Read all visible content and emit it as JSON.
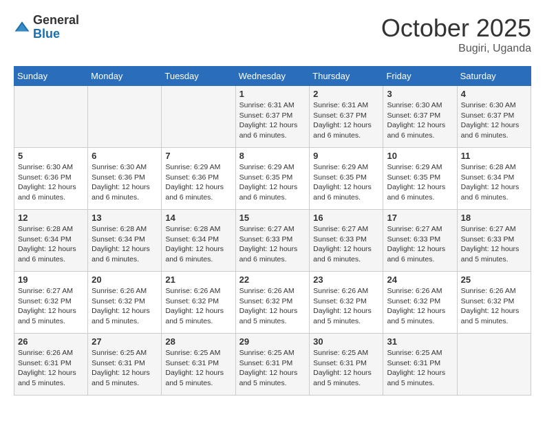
{
  "header": {
    "logo_general": "General",
    "logo_blue": "Blue",
    "month_title": "October 2025",
    "location": "Bugiri, Uganda"
  },
  "days_of_week": [
    "Sunday",
    "Monday",
    "Tuesday",
    "Wednesday",
    "Thursday",
    "Friday",
    "Saturday"
  ],
  "weeks": [
    [
      {
        "day": "",
        "info": ""
      },
      {
        "day": "",
        "info": ""
      },
      {
        "day": "",
        "info": ""
      },
      {
        "day": "1",
        "info": "Sunrise: 6:31 AM\nSunset: 6:37 PM\nDaylight: 12 hours\nand 6 minutes."
      },
      {
        "day": "2",
        "info": "Sunrise: 6:31 AM\nSunset: 6:37 PM\nDaylight: 12 hours\nand 6 minutes."
      },
      {
        "day": "3",
        "info": "Sunrise: 6:30 AM\nSunset: 6:37 PM\nDaylight: 12 hours\nand 6 minutes."
      },
      {
        "day": "4",
        "info": "Sunrise: 6:30 AM\nSunset: 6:37 PM\nDaylight: 12 hours\nand 6 minutes."
      }
    ],
    [
      {
        "day": "5",
        "info": "Sunrise: 6:30 AM\nSunset: 6:36 PM\nDaylight: 12 hours\nand 6 minutes."
      },
      {
        "day": "6",
        "info": "Sunrise: 6:30 AM\nSunset: 6:36 PM\nDaylight: 12 hours\nand 6 minutes."
      },
      {
        "day": "7",
        "info": "Sunrise: 6:29 AM\nSunset: 6:36 PM\nDaylight: 12 hours\nand 6 minutes."
      },
      {
        "day": "8",
        "info": "Sunrise: 6:29 AM\nSunset: 6:35 PM\nDaylight: 12 hours\nand 6 minutes."
      },
      {
        "day": "9",
        "info": "Sunrise: 6:29 AM\nSunset: 6:35 PM\nDaylight: 12 hours\nand 6 minutes."
      },
      {
        "day": "10",
        "info": "Sunrise: 6:29 AM\nSunset: 6:35 PM\nDaylight: 12 hours\nand 6 minutes."
      },
      {
        "day": "11",
        "info": "Sunrise: 6:28 AM\nSunset: 6:34 PM\nDaylight: 12 hours\nand 6 minutes."
      }
    ],
    [
      {
        "day": "12",
        "info": "Sunrise: 6:28 AM\nSunset: 6:34 PM\nDaylight: 12 hours\nand 6 minutes."
      },
      {
        "day": "13",
        "info": "Sunrise: 6:28 AM\nSunset: 6:34 PM\nDaylight: 12 hours\nand 6 minutes."
      },
      {
        "day": "14",
        "info": "Sunrise: 6:28 AM\nSunset: 6:34 PM\nDaylight: 12 hours\nand 6 minutes."
      },
      {
        "day": "15",
        "info": "Sunrise: 6:27 AM\nSunset: 6:33 PM\nDaylight: 12 hours\nand 6 minutes."
      },
      {
        "day": "16",
        "info": "Sunrise: 6:27 AM\nSunset: 6:33 PM\nDaylight: 12 hours\nand 6 minutes."
      },
      {
        "day": "17",
        "info": "Sunrise: 6:27 AM\nSunset: 6:33 PM\nDaylight: 12 hours\nand 6 minutes."
      },
      {
        "day": "18",
        "info": "Sunrise: 6:27 AM\nSunset: 6:33 PM\nDaylight: 12 hours\nand 5 minutes."
      }
    ],
    [
      {
        "day": "19",
        "info": "Sunrise: 6:27 AM\nSunset: 6:32 PM\nDaylight: 12 hours\nand 5 minutes."
      },
      {
        "day": "20",
        "info": "Sunrise: 6:26 AM\nSunset: 6:32 PM\nDaylight: 12 hours\nand 5 minutes."
      },
      {
        "day": "21",
        "info": "Sunrise: 6:26 AM\nSunset: 6:32 PM\nDaylight: 12 hours\nand 5 minutes."
      },
      {
        "day": "22",
        "info": "Sunrise: 6:26 AM\nSunset: 6:32 PM\nDaylight: 12 hours\nand 5 minutes."
      },
      {
        "day": "23",
        "info": "Sunrise: 6:26 AM\nSunset: 6:32 PM\nDaylight: 12 hours\nand 5 minutes."
      },
      {
        "day": "24",
        "info": "Sunrise: 6:26 AM\nSunset: 6:32 PM\nDaylight: 12 hours\nand 5 minutes."
      },
      {
        "day": "25",
        "info": "Sunrise: 6:26 AM\nSunset: 6:32 PM\nDaylight: 12 hours\nand 5 minutes."
      }
    ],
    [
      {
        "day": "26",
        "info": "Sunrise: 6:26 AM\nSunset: 6:31 PM\nDaylight: 12 hours\nand 5 minutes."
      },
      {
        "day": "27",
        "info": "Sunrise: 6:25 AM\nSunset: 6:31 PM\nDaylight: 12 hours\nand 5 minutes."
      },
      {
        "day": "28",
        "info": "Sunrise: 6:25 AM\nSunset: 6:31 PM\nDaylight: 12 hours\nand 5 minutes."
      },
      {
        "day": "29",
        "info": "Sunrise: 6:25 AM\nSunset: 6:31 PM\nDaylight: 12 hours\nand 5 minutes."
      },
      {
        "day": "30",
        "info": "Sunrise: 6:25 AM\nSunset: 6:31 PM\nDaylight: 12 hours\nand 5 minutes."
      },
      {
        "day": "31",
        "info": "Sunrise: 6:25 AM\nSunset: 6:31 PM\nDaylight: 12 hours\nand 5 minutes."
      },
      {
        "day": "",
        "info": ""
      }
    ]
  ]
}
